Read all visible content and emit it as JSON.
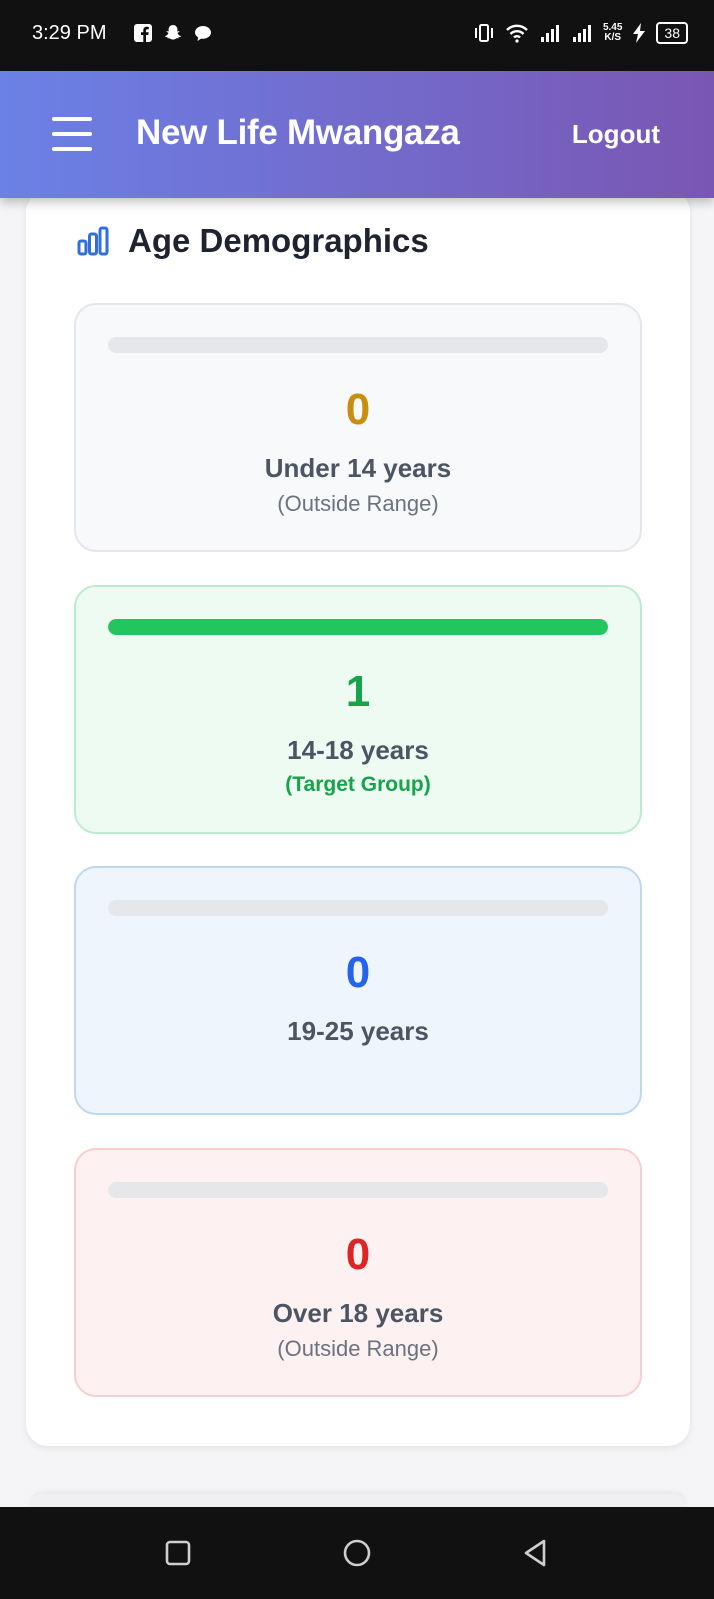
{
  "status_bar": {
    "time": "3:29 PM",
    "left_icons": [
      "facebook-icon",
      "snapchat-icon",
      "chat-bubble-icon"
    ],
    "net_speed_value": "5.45",
    "net_speed_unit": "K/S",
    "battery": "38"
  },
  "header": {
    "title": "New Life Mwangaza",
    "logout_label": "Logout",
    "menu_icon": "hamburger-menu-icon",
    "gradient_start": "#6b81e6",
    "gradient_end": "#7a56b3"
  },
  "section": {
    "title": "Age Demographics",
    "icon": "bar-chart-icon"
  },
  "age_groups": [
    {
      "value": "0",
      "label": "Under 14 years",
      "sublabel": "(Outside Range)",
      "fill_fraction": 0,
      "accent": "#c98e0f"
    },
    {
      "value": "1",
      "label": "14-18 years",
      "sublabel": "(Target Group)",
      "fill_fraction": 1,
      "accent": "#16a34a"
    },
    {
      "value": "0",
      "label": "19-25 years",
      "sublabel": "",
      "fill_fraction": 0,
      "accent": "#2563eb"
    },
    {
      "value": "0",
      "label": "Over 18 years",
      "sublabel": "(Outside Range)",
      "fill_fraction": 0,
      "accent": "#dc2626"
    }
  ],
  "nav_bar": {
    "buttons": [
      "recents-square-icon",
      "home-circle-icon",
      "back-triangle-icon"
    ]
  }
}
